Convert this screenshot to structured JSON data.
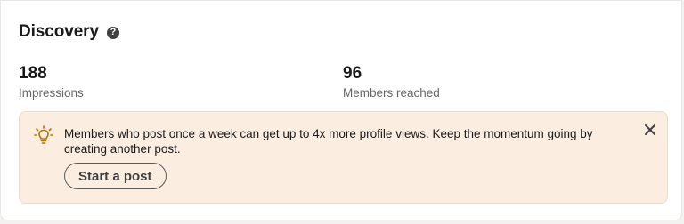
{
  "section": {
    "title": "Discovery",
    "help_icon_glyph": "?"
  },
  "metrics": [
    {
      "value": "188",
      "label": "Impressions"
    },
    {
      "value": "96",
      "label": "Members reached"
    }
  ],
  "tip": {
    "icon": "lightbulb-icon",
    "message": "Members who post once a week can get up to 4x more profile views. Keep the momentum going by creating another post.",
    "action_label": "Start a post",
    "close_icon": "close-icon"
  },
  "colors": {
    "tip_background": "#fbeee0",
    "bulb_accent": "#b47300",
    "text_primary": "#191919",
    "text_secondary": "#666666"
  }
}
